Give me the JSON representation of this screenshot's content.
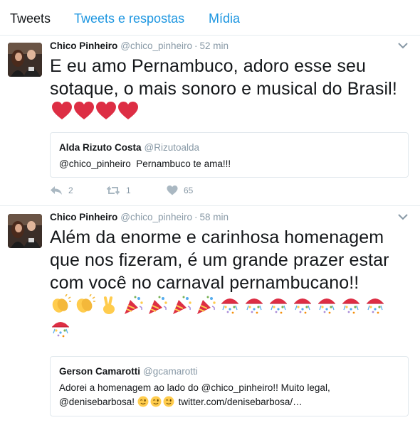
{
  "tabs": {
    "tweets": "Tweets",
    "replies": "Tweets e respostas",
    "media": "Mídia"
  },
  "tweets": [
    {
      "name": "Chico Pinheiro",
      "handle": "@chico_pinheiro",
      "dot": "·",
      "time": "52 min",
      "text": "E eu amo Pernambuco, adoro esse seu sotaque, o mais sonoro e musical do Brasil!",
      "emoji": [
        "red-heart",
        "red-heart",
        "red-heart",
        "red-heart"
      ],
      "quote": {
        "name": "Alda Rizuto Costa",
        "handle": "@Rizutoalda",
        "text": "@chico_pinheiro  Pernambuco te ama!!!"
      },
      "replies": "2",
      "retweets": "1",
      "likes": "65"
    },
    {
      "name": "Chico Pinheiro",
      "handle": "@chico_pinheiro",
      "dot": "·",
      "time": "58 min",
      "text": "Além da enorme e carinhosa homenagem que nos fizeram, é um grande prazer estar com você no carnaval pernambucano!!",
      "emoji": [
        "clapping-hands",
        "clapping-hands",
        "victory-hand",
        "party-popper",
        "party-popper",
        "party-popper",
        "party-popper",
        "confetti-ball",
        "confetti-ball",
        "confetti-ball",
        "confetti-ball",
        "confetti-ball",
        "confetti-ball",
        "confetti-ball",
        "confetti-ball"
      ],
      "quote": {
        "name": "Gerson Camarotti",
        "handle": "@gcamarotti",
        "line1": "Adorei a homenagem ao lado do @chico_pinheiro!! Muito legal,",
        "line2_prefix": "@denisebarbosa!",
        "line2_emoji": [
          "winking-face",
          "winking-face",
          "winking-face"
        ],
        "line2_link": "twitter.com/denisebarbosa/…"
      }
    }
  ],
  "colors": {
    "accent": "#1b95e0",
    "muted": "#8899a6",
    "border": "#e1e8ed",
    "heart": "#dd2e44"
  }
}
